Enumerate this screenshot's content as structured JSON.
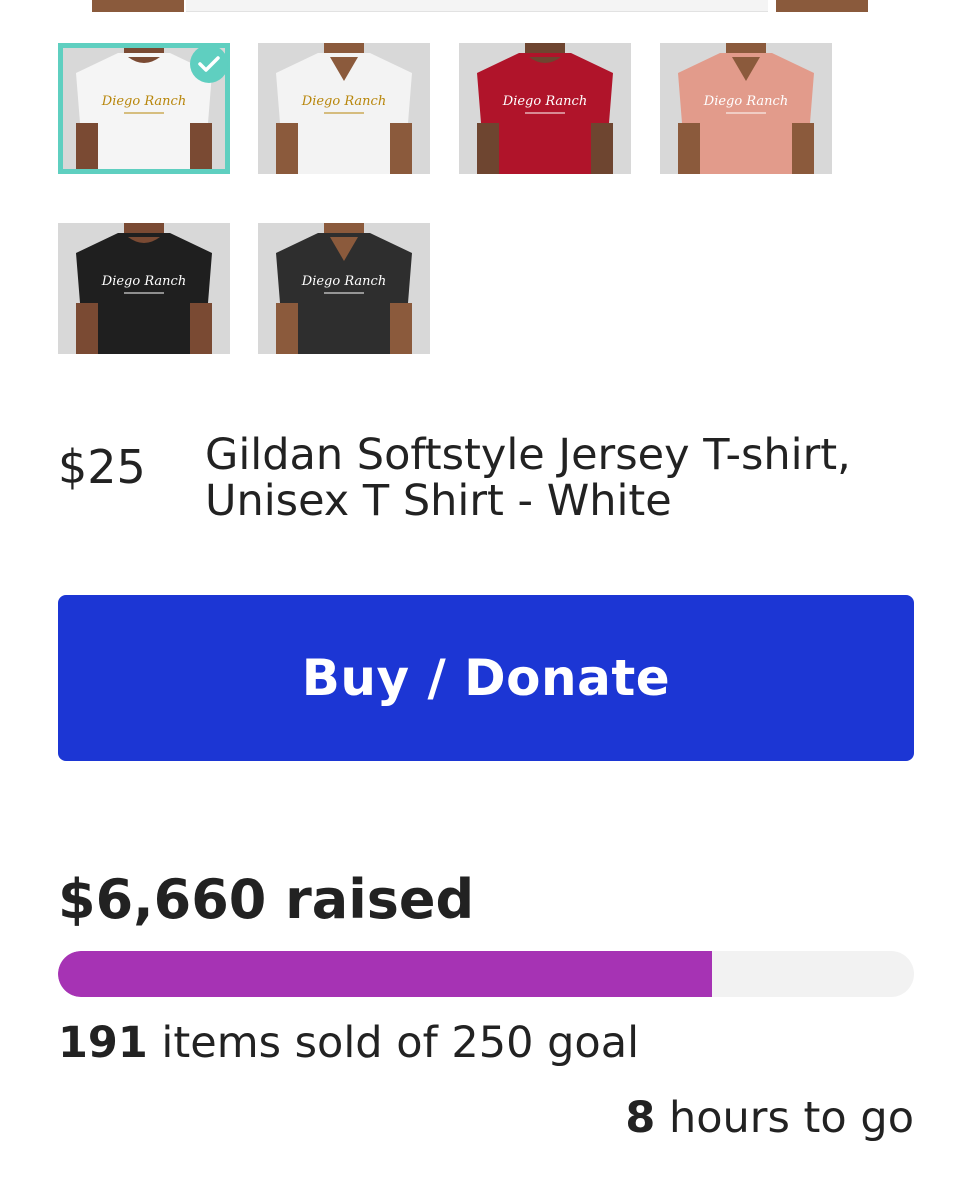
{
  "gallery": {
    "selected_index": 0,
    "thumbnails": [
      {
        "name": "white-crew-tshirt",
        "shirt_color": "#f5f5f5",
        "skin_color": "#7a4a33",
        "neck": "crew",
        "logo_color": "#b8860b",
        "logo_text": "Diego Ranch"
      },
      {
        "name": "white-vneck-tshirt",
        "shirt_color": "#f3f3f3",
        "skin_color": "#8b5a3c",
        "neck": "v",
        "logo_color": "#b8860b",
        "logo_text": "Diego Ranch"
      },
      {
        "name": "red-crew-tshirt",
        "shirt_color": "#b0142a",
        "skin_color": "#6e4530",
        "neck": "crew",
        "logo_color": "#ffffff",
        "logo_text": "Diego Ranch"
      },
      {
        "name": "pink-vneck-tshirt",
        "shirt_color": "#e29b8b",
        "skin_color": "#8b5a3c",
        "neck": "v",
        "logo_color": "#ffffff",
        "logo_text": "Diego Ranch"
      },
      {
        "name": "black-crew-tshirt",
        "shirt_color": "#1f1f1f",
        "skin_color": "#7a4a33",
        "neck": "crew",
        "logo_color": "#ffffff",
        "logo_text": "Diego Ranch"
      },
      {
        "name": "charcoal-vneck-tshirt",
        "shirt_color": "#2e2e2e",
        "skin_color": "#8b5a3c",
        "neck": "v",
        "logo_color": "#ffffff",
        "logo_text": "Diego Ranch"
      }
    ]
  },
  "product": {
    "price": "$25",
    "title": "Gildan Softstyle Jersey T-shirt, Unisex T Shirt - White"
  },
  "actions": {
    "buy_label": "Buy / Donate",
    "buy_color": "#1c36d4"
  },
  "fundraiser": {
    "raised_text": "$6,660 raised",
    "items_sold": "191",
    "items_sold_suffix": " items sold of 250 goal",
    "goal": 250,
    "progress_fraction": 0.764,
    "progress_color": "#a633b4",
    "hours_left": "8",
    "hours_left_suffix": " hours to go"
  }
}
